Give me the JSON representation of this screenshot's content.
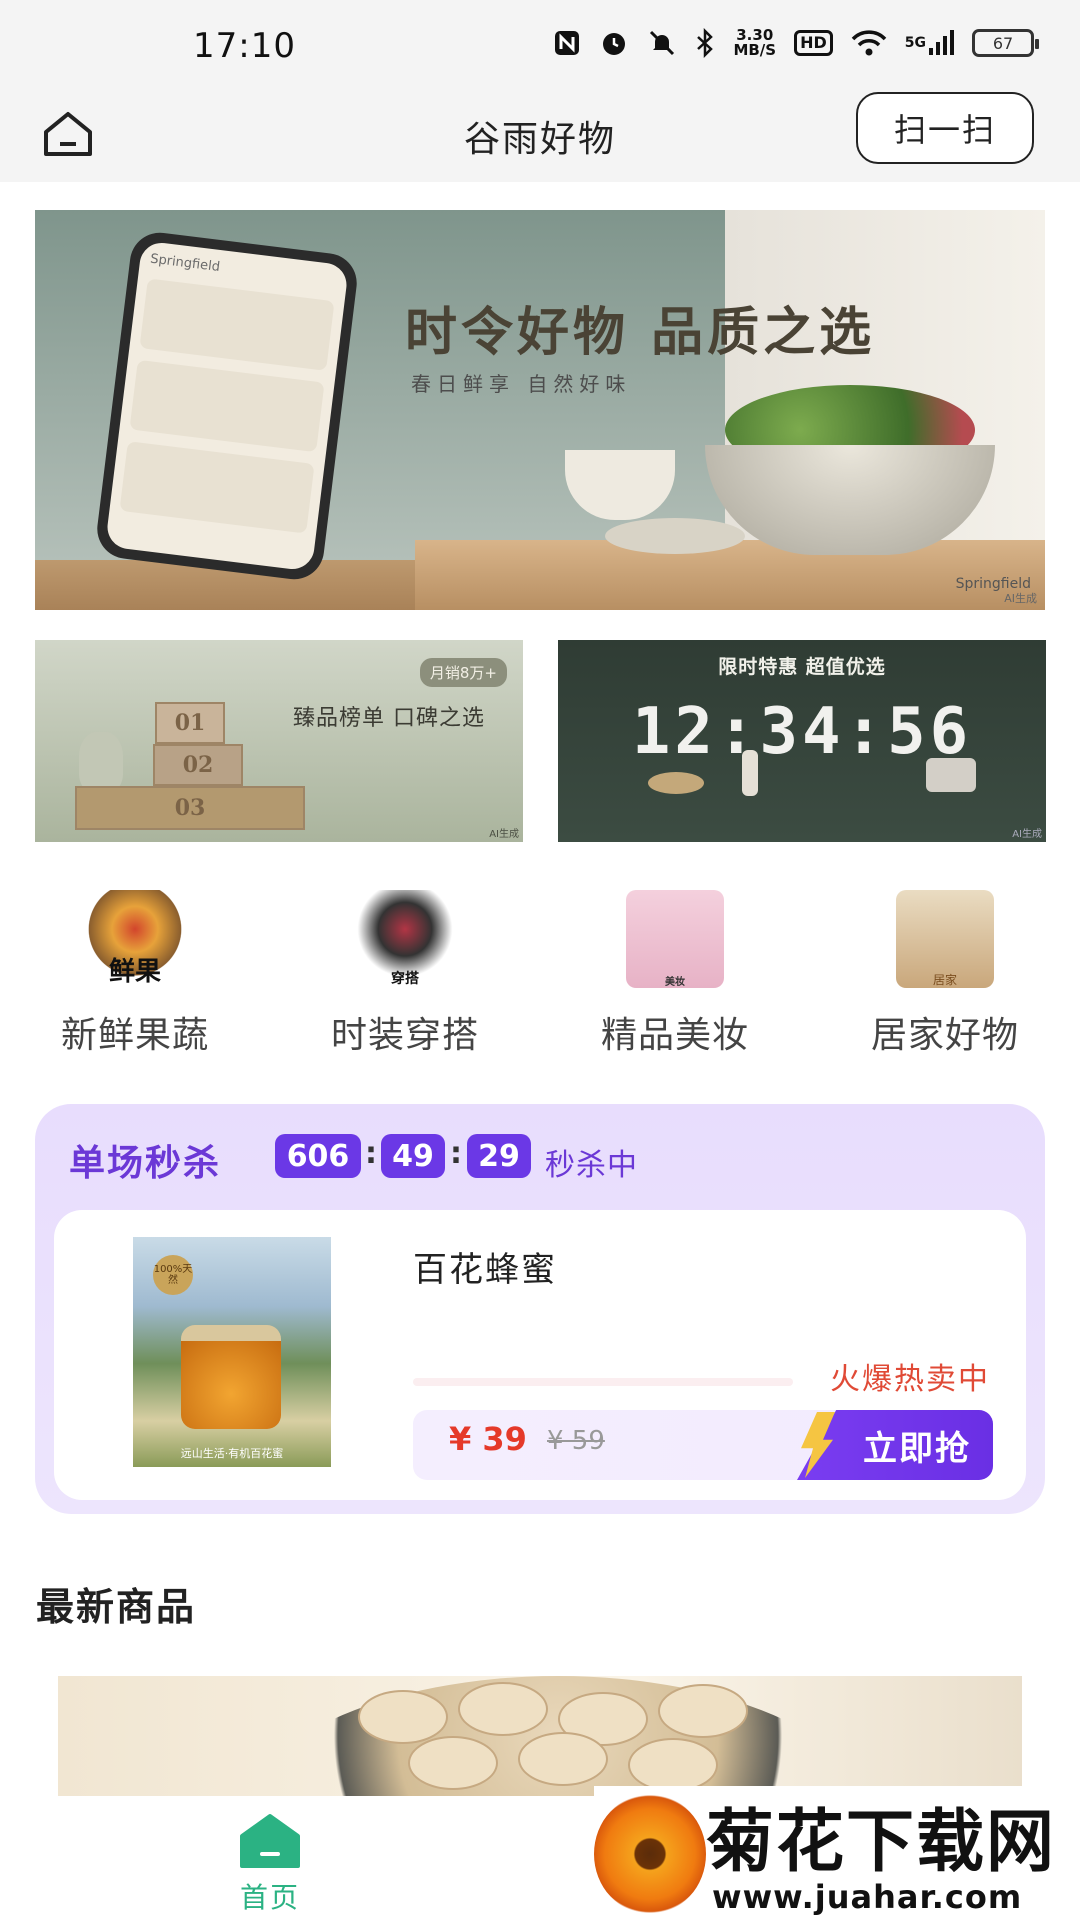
{
  "status_bar": {
    "time": "17:10",
    "speed_value": "3.30",
    "speed_unit": "MB/S",
    "hd": "HD",
    "network": "5G",
    "battery": "67"
  },
  "header": {
    "title": "谷雨好物",
    "scan_label": "扫一扫"
  },
  "banner": {
    "headline": "时令好物 品质之选",
    "subheadline": "春日鲜享  自然好味",
    "phone_brand": "Springfield",
    "brand": "Springfield",
    "ai_mark": "AI生成"
  },
  "promos": [
    {
      "badge": "月销8万+",
      "title": "臻品榜单 口碑之选",
      "ranks": [
        "01",
        "02",
        "03"
      ],
      "ai_mark": "AI生成"
    },
    {
      "title": "限时特惠 超值优选",
      "countdown": "12:34:56",
      "ai_mark": "AI生成"
    }
  ],
  "categories": [
    {
      "label": "新鲜果蔬",
      "icon_text": "鲜果",
      "icon": "fruit-basket-icon"
    },
    {
      "label": "时装穿搭",
      "icon_text": "穿搭",
      "icon": "fashion-icon"
    },
    {
      "label": "精品美妆",
      "icon_text": "美妆",
      "icon": "cosmetics-icon"
    },
    {
      "label": "居家好物",
      "icon_text": "居家",
      "icon": "home-goods-icon"
    }
  ],
  "flash_sale": {
    "title": "单场秒杀",
    "hours": "606",
    "minutes": "49",
    "seconds": "29",
    "status": "秒杀中",
    "product": {
      "name": "百花蜂蜜",
      "badge": "100%天然",
      "caption": "远山生活·有机百花蜜",
      "hot_label": "火爆热卖中",
      "price": "¥ 39",
      "original_price": "¥ 59",
      "buy_label": "立即抢"
    }
  },
  "latest": {
    "title": "最新商品"
  },
  "tabbar": {
    "home_label": "首页"
  },
  "watermark": {
    "text": "菊花下载网",
    "url": "www.juahar.com"
  },
  "colors": {
    "accent_purple": "#6b38e6",
    "price_red": "#e53929",
    "tab_green": "#2bb283"
  }
}
